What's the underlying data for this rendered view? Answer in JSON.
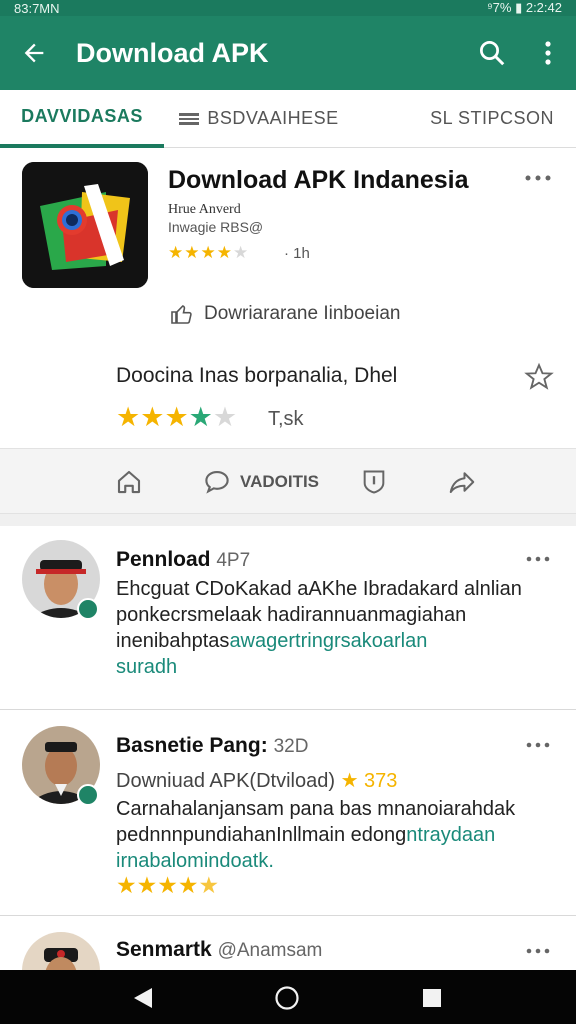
{
  "status_bar": {
    "left": "83:7MN",
    "right": "⁹7% ▮ 2:2:42"
  },
  "app_bar": {
    "title": "Download APK"
  },
  "tabs": [
    "DAVVIDASAS",
    "BSDVAAIHESE",
    "SL STIPCSON"
  ],
  "app": {
    "name": "Download APK Indanesia",
    "developer_line1": "Hrue Anverd",
    "developer_line2": "Inwagie RBS@",
    "rating_small": 3.5,
    "rating_small_count": "· 1h",
    "download_label": "Dowriararane Iinboeian",
    "description": "Doocina Inas borpanalia, Dhel",
    "rating_big": 4,
    "rating_big_count": "T,sk"
  },
  "actions": {
    "comment_label": "VADOITIS"
  },
  "posts": [
    {
      "name": "Pennload",
      "handle": "4P7",
      "lines": [
        "Ehcguat CDoKakad aAKhe Ibradakard alnlian",
        "ponkecrsmelaak hadirannuanmagiahan"
      ],
      "text_plain": "inenibahptas",
      "text_link": "awagertringrsakoarlan",
      "text_link2": "suradh"
    },
    {
      "name": "Basnetie Pang:",
      "handle": "32D",
      "subtitle": "Downiuad APK(Dtviload)",
      "subtitle_rating": "★ 373",
      "lines": [
        "Carnahalanjansam pana bas mnanoiarahdak"
      ],
      "text_plain": "pednnnpundiahanInllmain edong",
      "text_link": "ntraydaan",
      "text_link2": "irnabalomindoatk.",
      "rating": 4.5
    },
    {
      "name": "Senmartk",
      "handle": "@Anamsam"
    }
  ],
  "colors": {
    "primary": "#1f8466",
    "star": "#f5b400",
    "link": "#1a8a7a"
  },
  "icons": [
    "back-arrow-icon",
    "search-icon",
    "overflow-menu-icon",
    "like-icon",
    "star-outline-icon",
    "home-icon",
    "comment-icon",
    "shield-icon",
    "share-icon",
    "nav-back-icon",
    "nav-home-icon",
    "nav-recents-icon"
  ]
}
